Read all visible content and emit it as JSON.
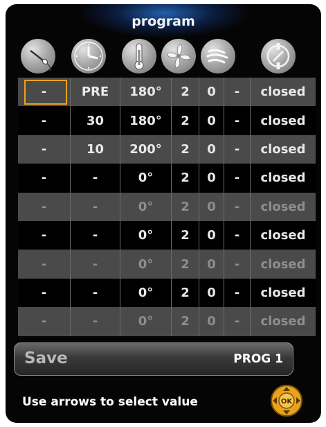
{
  "header": {
    "title": "program"
  },
  "icons": [
    "probe-icon",
    "clock-icon",
    "thermometer-icon",
    "fan-icon",
    "steam-icon",
    "damper-icon"
  ],
  "rows": [
    [
      "-",
      "PRE",
      "180°",
      "2",
      "0",
      "-",
      "closed"
    ],
    [
      "-",
      "30",
      "180°",
      "2",
      "0",
      "-",
      "closed"
    ],
    [
      "-",
      "10",
      "200°",
      "2",
      "0",
      "-",
      "closed"
    ],
    [
      "-",
      "-",
      "0°",
      "2",
      "0",
      "-",
      "closed"
    ],
    [
      "-",
      "-",
      "0°",
      "2",
      "0",
      "-",
      "closed"
    ],
    [
      "-",
      "-",
      "0°",
      "2",
      "0",
      "-",
      "closed"
    ],
    [
      "-",
      "-",
      "0°",
      "2",
      "0",
      "-",
      "closed"
    ],
    [
      "-",
      "-",
      "0°",
      "2",
      "0",
      "-",
      "closed"
    ],
    [
      "-",
      "-",
      "0°",
      "2",
      "0",
      "-",
      "closed"
    ]
  ],
  "save_bar": {
    "label": "Save",
    "program": "PROG 1"
  },
  "footer": {
    "hint": "Use arrows to select value",
    "ok_label": "OK"
  },
  "colors": {
    "accent": "#e8a21f",
    "row_alt": "#4a4a4a",
    "row_base": "#000000"
  }
}
